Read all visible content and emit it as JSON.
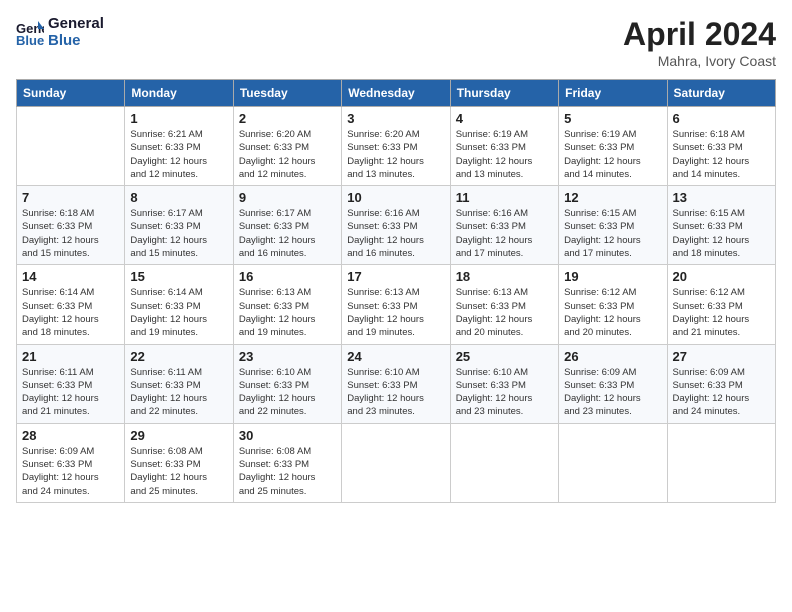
{
  "header": {
    "logo_line1": "General",
    "logo_line2": "Blue",
    "month_title": "April 2024",
    "subtitle": "Mahra, Ivory Coast"
  },
  "days_of_week": [
    "Sunday",
    "Monday",
    "Tuesday",
    "Wednesday",
    "Thursday",
    "Friday",
    "Saturday"
  ],
  "weeks": [
    [
      {
        "day": "",
        "info": ""
      },
      {
        "day": "1",
        "info": "Sunrise: 6:21 AM\nSunset: 6:33 PM\nDaylight: 12 hours\nand 12 minutes."
      },
      {
        "day": "2",
        "info": "Sunrise: 6:20 AM\nSunset: 6:33 PM\nDaylight: 12 hours\nand 12 minutes."
      },
      {
        "day": "3",
        "info": "Sunrise: 6:20 AM\nSunset: 6:33 PM\nDaylight: 12 hours\nand 13 minutes."
      },
      {
        "day": "4",
        "info": "Sunrise: 6:19 AM\nSunset: 6:33 PM\nDaylight: 12 hours\nand 13 minutes."
      },
      {
        "day": "5",
        "info": "Sunrise: 6:19 AM\nSunset: 6:33 PM\nDaylight: 12 hours\nand 14 minutes."
      },
      {
        "day": "6",
        "info": "Sunrise: 6:18 AM\nSunset: 6:33 PM\nDaylight: 12 hours\nand 14 minutes."
      }
    ],
    [
      {
        "day": "7",
        "info": "Sunrise: 6:18 AM\nSunset: 6:33 PM\nDaylight: 12 hours\nand 15 minutes."
      },
      {
        "day": "8",
        "info": "Sunrise: 6:17 AM\nSunset: 6:33 PM\nDaylight: 12 hours\nand 15 minutes."
      },
      {
        "day": "9",
        "info": "Sunrise: 6:17 AM\nSunset: 6:33 PM\nDaylight: 12 hours\nand 16 minutes."
      },
      {
        "day": "10",
        "info": "Sunrise: 6:16 AM\nSunset: 6:33 PM\nDaylight: 12 hours\nand 16 minutes."
      },
      {
        "day": "11",
        "info": "Sunrise: 6:16 AM\nSunset: 6:33 PM\nDaylight: 12 hours\nand 17 minutes."
      },
      {
        "day": "12",
        "info": "Sunrise: 6:15 AM\nSunset: 6:33 PM\nDaylight: 12 hours\nand 17 minutes."
      },
      {
        "day": "13",
        "info": "Sunrise: 6:15 AM\nSunset: 6:33 PM\nDaylight: 12 hours\nand 18 minutes."
      }
    ],
    [
      {
        "day": "14",
        "info": "Sunrise: 6:14 AM\nSunset: 6:33 PM\nDaylight: 12 hours\nand 18 minutes."
      },
      {
        "day": "15",
        "info": "Sunrise: 6:14 AM\nSunset: 6:33 PM\nDaylight: 12 hours\nand 19 minutes."
      },
      {
        "day": "16",
        "info": "Sunrise: 6:13 AM\nSunset: 6:33 PM\nDaylight: 12 hours\nand 19 minutes."
      },
      {
        "day": "17",
        "info": "Sunrise: 6:13 AM\nSunset: 6:33 PM\nDaylight: 12 hours\nand 19 minutes."
      },
      {
        "day": "18",
        "info": "Sunrise: 6:13 AM\nSunset: 6:33 PM\nDaylight: 12 hours\nand 20 minutes."
      },
      {
        "day": "19",
        "info": "Sunrise: 6:12 AM\nSunset: 6:33 PM\nDaylight: 12 hours\nand 20 minutes."
      },
      {
        "day": "20",
        "info": "Sunrise: 6:12 AM\nSunset: 6:33 PM\nDaylight: 12 hours\nand 21 minutes."
      }
    ],
    [
      {
        "day": "21",
        "info": "Sunrise: 6:11 AM\nSunset: 6:33 PM\nDaylight: 12 hours\nand 21 minutes."
      },
      {
        "day": "22",
        "info": "Sunrise: 6:11 AM\nSunset: 6:33 PM\nDaylight: 12 hours\nand 22 minutes."
      },
      {
        "day": "23",
        "info": "Sunrise: 6:10 AM\nSunset: 6:33 PM\nDaylight: 12 hours\nand 22 minutes."
      },
      {
        "day": "24",
        "info": "Sunrise: 6:10 AM\nSunset: 6:33 PM\nDaylight: 12 hours\nand 23 minutes."
      },
      {
        "day": "25",
        "info": "Sunrise: 6:10 AM\nSunset: 6:33 PM\nDaylight: 12 hours\nand 23 minutes."
      },
      {
        "day": "26",
        "info": "Sunrise: 6:09 AM\nSunset: 6:33 PM\nDaylight: 12 hours\nand 23 minutes."
      },
      {
        "day": "27",
        "info": "Sunrise: 6:09 AM\nSunset: 6:33 PM\nDaylight: 12 hours\nand 24 minutes."
      }
    ],
    [
      {
        "day": "28",
        "info": "Sunrise: 6:09 AM\nSunset: 6:33 PM\nDaylight: 12 hours\nand 24 minutes."
      },
      {
        "day": "29",
        "info": "Sunrise: 6:08 AM\nSunset: 6:33 PM\nDaylight: 12 hours\nand 25 minutes."
      },
      {
        "day": "30",
        "info": "Sunrise: 6:08 AM\nSunset: 6:33 PM\nDaylight: 12 hours\nand 25 minutes."
      },
      {
        "day": "",
        "info": ""
      },
      {
        "day": "",
        "info": ""
      },
      {
        "day": "",
        "info": ""
      },
      {
        "day": "",
        "info": ""
      }
    ]
  ]
}
